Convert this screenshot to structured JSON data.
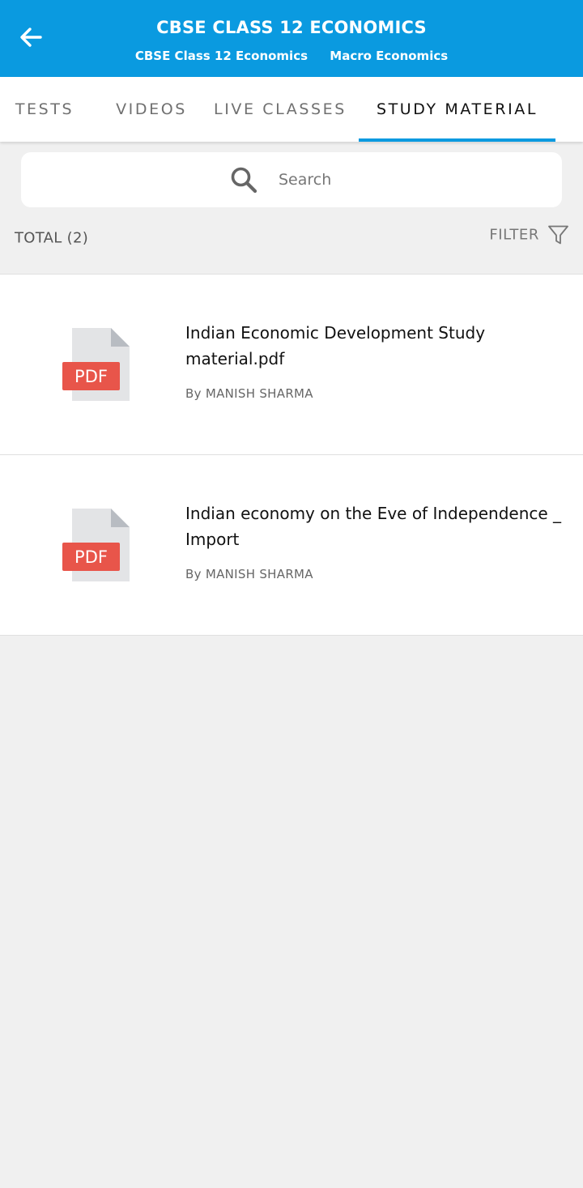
{
  "header": {
    "title": "CBSE CLASS 12 ECONOMICS",
    "subtitle_1": "CBSE Class 12 Economics",
    "subtitle_2": "Macro Economics"
  },
  "tabs": [
    {
      "label": "TESTS"
    },
    {
      "label": "VIDEOS"
    },
    {
      "label": "LIVE CLASSES"
    },
    {
      "label": "STUDY MATERIAL",
      "active": true
    }
  ],
  "search": {
    "placeholder": "Search"
  },
  "summary": {
    "total": "TOTAL (2)",
    "filter_label": "FILTER"
  },
  "items": [
    {
      "title": "Indian Economic Development Study material.pdf",
      "author": "By MANISH SHARMA",
      "icon_label": "PDF"
    },
    {
      "title": "Indian economy on the Eve of Independence _ Import",
      "author": "By MANISH SHARMA",
      "icon_label": "PDF"
    }
  ],
  "colors": {
    "primary": "#0a9ae0",
    "pdf_red": "#e8554a",
    "background": "#f0f0f0"
  }
}
